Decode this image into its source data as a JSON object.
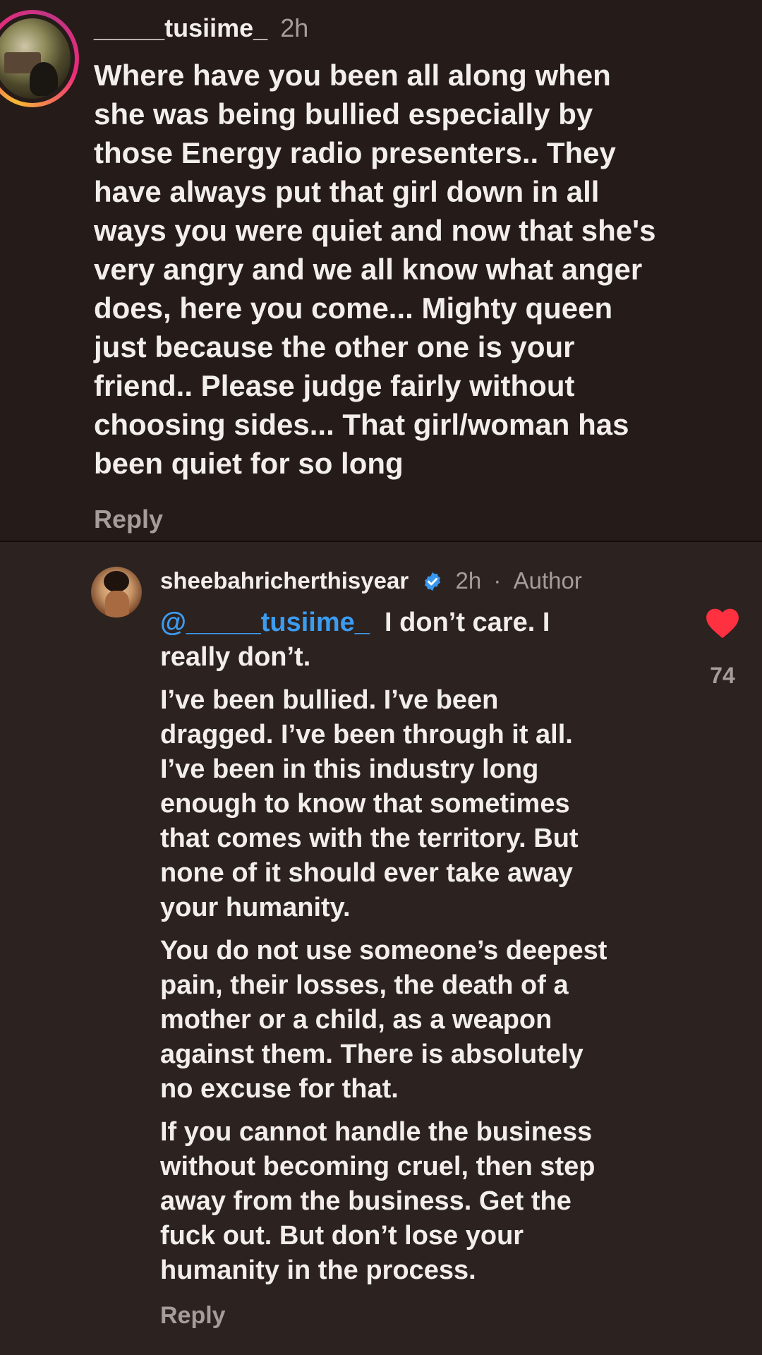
{
  "comment": {
    "username": "_____tusiime_",
    "time": "2h",
    "text": "Where have you been all along when\nshe was being bullied especially by\nthose Energy radio presenters.. They\nhave always put that girl down in all\nways you were quiet and now that she's\nvery angry and we all know what anger\ndoes, here you come... Mighty queen\njust because the other one is your\nfriend.. Please  judge fairly without\nchoosing sides... That girl/woman has\nbeen quiet for so long",
    "reply_label": "Reply"
  },
  "reply": {
    "username": "sheebahricherthisyear",
    "time": "2h",
    "separator": "·",
    "author_label": "Author",
    "mention": "@_____tusiime_",
    "first_line_rest": "I don’t care. I\nreally don’t.",
    "paragraph_2": "I’ve been bullied. I’ve been\ndragged. I’ve been through it all.\nI’ve been in this industry long\nenough to know that sometimes\nthat comes with the territory. But\nnone of it should ever take away\nyour humanity.",
    "paragraph_3": "You do not use someone’s deepest\npain, their losses, the death of a\nmother or a child, as a weapon\nagainst them. There is absolutely\nno excuse for that.",
    "paragraph_4": "If you cannot handle the business\nwithout becoming cruel, then step\naway from the business. Get the\nfuck out. But don’t lose your\nhumanity in the process.",
    "like_count": "74",
    "like_icon": "heart-filled-icon",
    "verified_icon": "verified-badge-icon",
    "reply_label": "Reply"
  },
  "colors": {
    "background": "#251b19",
    "reply_background": "#2c2220",
    "text": "#f2eeec",
    "muted": "#a59d9a",
    "mention": "#3c9cf0",
    "like": "#ff3040",
    "verified": "#3897f0"
  }
}
